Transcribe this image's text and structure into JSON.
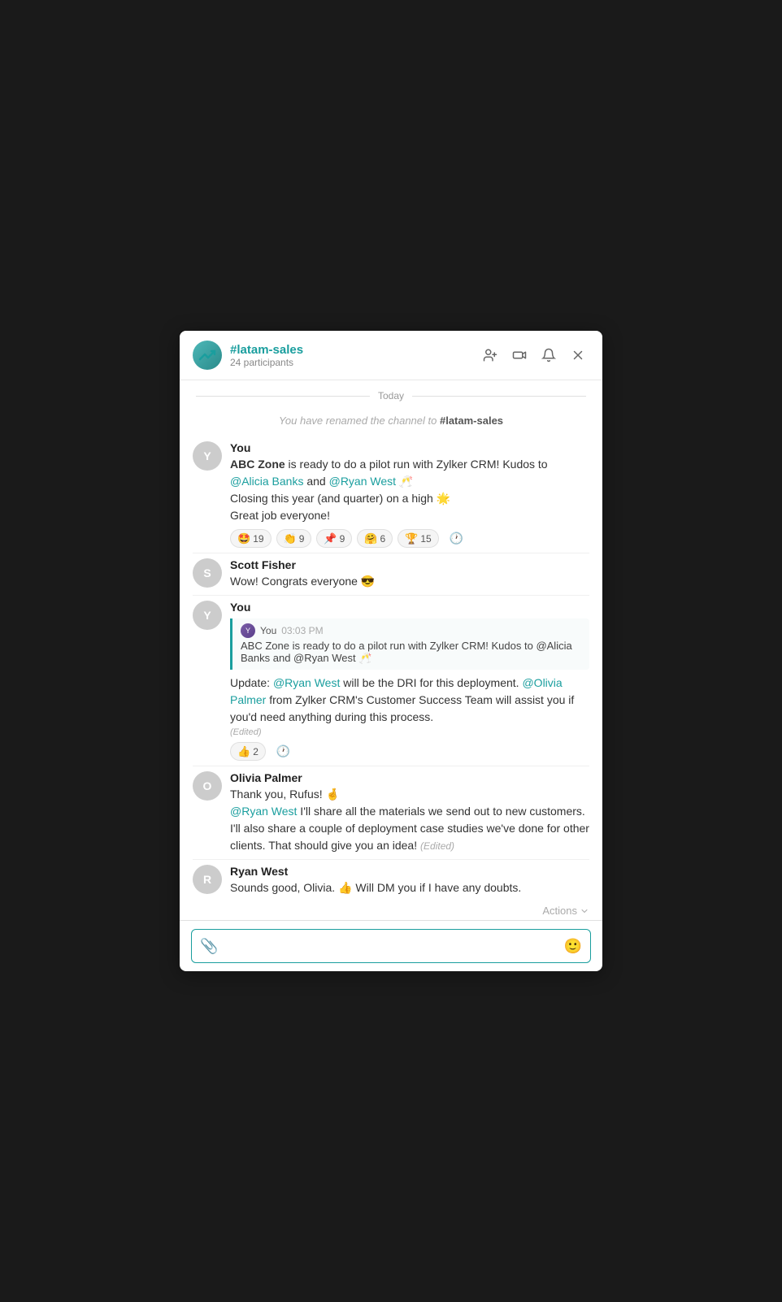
{
  "header": {
    "channel": "#latam-sales",
    "participants": "24 participants",
    "actions": [
      "add-person-icon",
      "video-icon",
      "bell-icon",
      "close-icon"
    ]
  },
  "date_divider": "Today",
  "system_message": "You have renamed the channel to #latam-sales",
  "messages": [
    {
      "id": "msg1",
      "sender": "You",
      "avatar_type": "you",
      "avatar_label": "Y",
      "content_html": "<span class='bold'>ABC Zone</span> is ready to do a pilot run with Zylker CRM! Kudos to <span class='mention'>@Alicia Banks</span> and <span class='mention'>@Ryan West</span> 🥂 Closing this year (and quarter) on a high 🌟 Great job everyone!",
      "reactions": [
        {
          "emoji": "🤩",
          "count": "19"
        },
        {
          "emoji": "👏",
          "count": "9"
        },
        {
          "emoji": "📌",
          "count": "9"
        },
        {
          "emoji": "🤗",
          "count": "6"
        },
        {
          "emoji": "🏆",
          "count": "15"
        }
      ]
    },
    {
      "id": "msg2",
      "sender": "Scott Fisher",
      "avatar_type": "scott",
      "avatar_label": "S",
      "content_html": "Wow! Congrats everyone 😎"
    },
    {
      "id": "msg3",
      "sender": "You",
      "avatar_type": "you",
      "avatar_label": "Y",
      "quote": {
        "sender": "You",
        "time": "03:03 PM",
        "text": "ABC Zone is ready to do a pilot run with Zylker CRM! Kudos to @Alicia Banks and @Ryan West 🥂"
      },
      "content_html": "Update: <span class='mention'>@Ryan West</span> will be the DRI for this deployment. <span class='mention'>@Olivia Palmer</span> from Zylker CRM's Customer Success Team will assist you if you'd need anything during this process.",
      "edited": true,
      "reactions": [
        {
          "emoji": "👍",
          "count": "2"
        }
      ]
    },
    {
      "id": "msg4",
      "sender": "Olivia Palmer",
      "avatar_type": "olivia",
      "avatar_label": "O",
      "content_html": "Thank you, Rufus! 🤞 <span class='mention'>@Ryan West</span> I'll share all the materials we send out to new customers. I'll also share a couple of deployment case studies we've done for other clients. That should give you an idea!",
      "edited": true
    },
    {
      "id": "msg5",
      "sender": "Ryan West",
      "avatar_type": "ryan",
      "avatar_label": "R",
      "content_html": "Sounds good, Olivia. 👍 Will DM you if I have any doubts."
    }
  ],
  "actions_label": "Actions",
  "input": {
    "placeholder": "",
    "attach_icon": "📎",
    "emoji_icon": "🙂"
  }
}
